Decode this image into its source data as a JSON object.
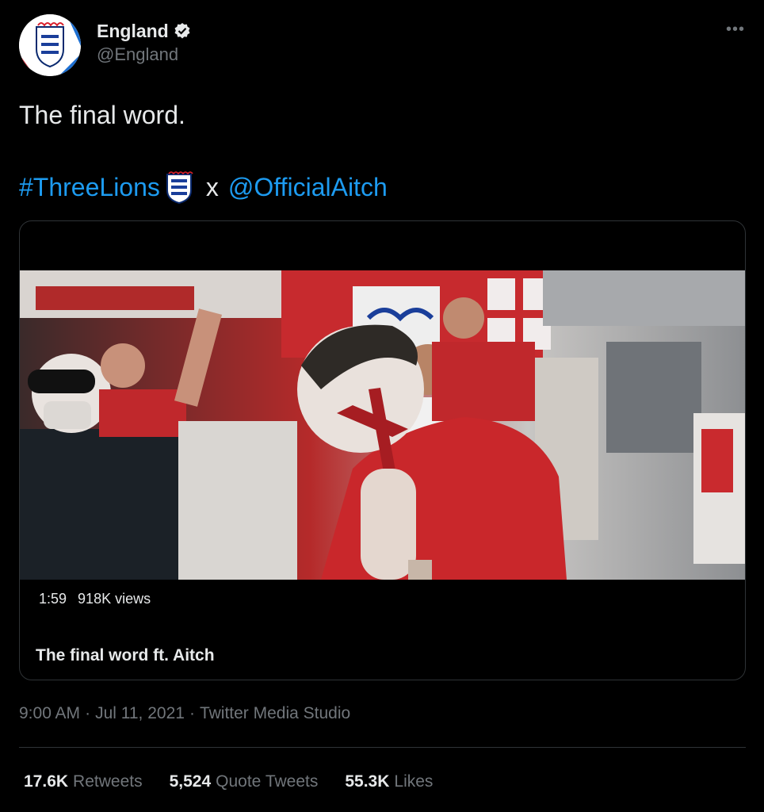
{
  "author": {
    "display_name": "England",
    "handle": "@England",
    "verified": true
  },
  "tweet": {
    "text_line1": "The final word.",
    "hashtag": "#ThreeLions",
    "separator": "x",
    "mention": "@OfficialAitch"
  },
  "media": {
    "duration": "1:59",
    "views": "918K views",
    "title": "The final word ft. Aitch"
  },
  "meta": {
    "time": "9:00 AM",
    "dot1": "·",
    "date": "Jul 11, 2021",
    "dot2": "·",
    "source": "Twitter Media Studio"
  },
  "stats": [
    {
      "value": "17.6K",
      "label": "Retweets"
    },
    {
      "value": "5,524",
      "label": "Quote Tweets"
    },
    {
      "value": "55.3K",
      "label": "Likes"
    }
  ],
  "icons": {
    "more": "more-icon",
    "verified": "verified-badge-icon",
    "crest": "three-lions-crest-icon"
  },
  "colors": {
    "link": "#1d9bf0",
    "muted": "#71767b",
    "text": "#e7e9ea",
    "background": "#000000",
    "verified_badge": "#e7e9ea"
  }
}
